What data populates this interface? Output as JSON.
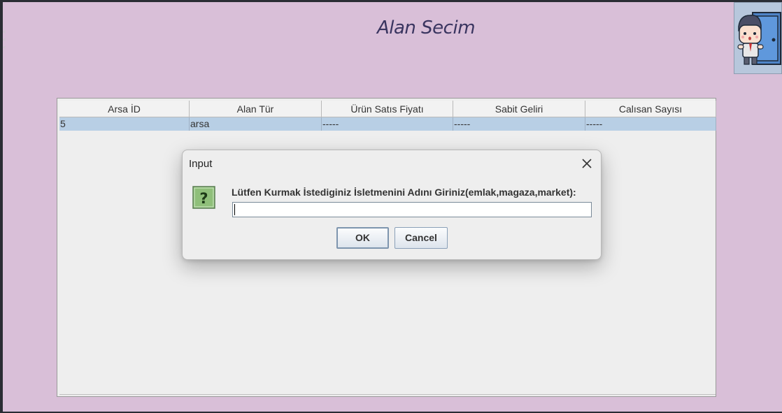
{
  "window": {
    "title": "Alan Secim"
  },
  "exit_button": {
    "icon": "exit-door-person-icon"
  },
  "table": {
    "columns": [
      "Arsa İD",
      "Alan Tür",
      "Ürün Satıs Fiyatı",
      "Sabit Geliri",
      "Calısan Sayısı"
    ],
    "rows": [
      [
        "5",
        "arsa",
        "-----",
        "-----",
        "-----"
      ]
    ],
    "selected_row_color": "#b8cfe5"
  },
  "dialog": {
    "title": "Input",
    "close_icon": "close-icon",
    "question_icon": "question-icon",
    "prompt": "Lütfen Kurmak İstediginiz İsletmenini Adını Giriniz(emlak,magaza,market):",
    "input_value": "",
    "ok_label": "OK",
    "cancel_label": "Cancel"
  },
  "colors": {
    "background": "#d9bfd8",
    "title": "#3a3560",
    "question_icon_bg": "#8fbf7a"
  }
}
